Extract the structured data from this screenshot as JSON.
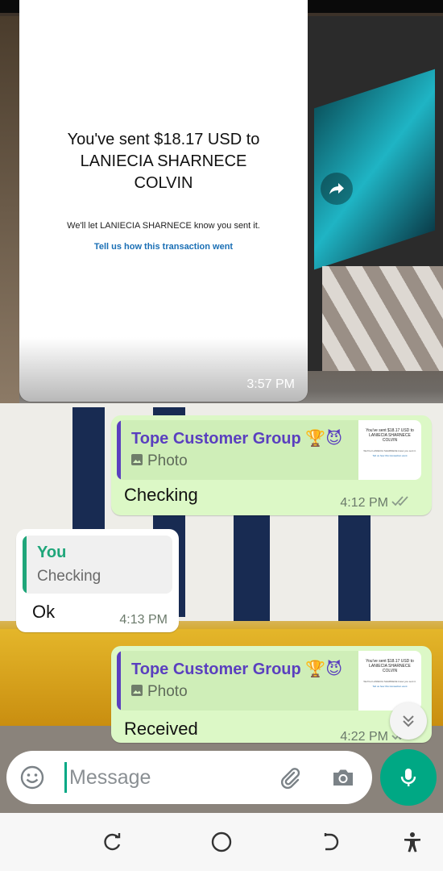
{
  "colors": {
    "outgoing_bubble": "#dcf8c6",
    "incoming_bubble": "#ffffff",
    "accent_green": "#00a884",
    "group_name_purple": "#5a3fbf",
    "you_green": "#1fa67a",
    "link_blue": "#1a6fb5"
  },
  "image_message": {
    "receipt_title": "You've sent $18.17 USD to LANIECIA SHARNECE COLVIN",
    "receipt_note": "We'll let LANIECIA SHARNECE know you sent it.",
    "receipt_link": "Tell us how this transaction went",
    "time": "3:57 PM",
    "forward_icon": "forward-arrow-icon"
  },
  "messages": [
    {
      "direction": "out",
      "quote_author": "Tope Customer Group 🏆😈",
      "quote_type_icon": "image-icon",
      "quote_type_label": "Photo",
      "quote_thumb_title": "You've sent $18.17 USD to LANIECIA SHARNECE COLVIN",
      "quote_thumb_note": "We'll let LANIECIA SHARNECE know you sent it.",
      "quote_thumb_link": "Tell us how this transaction went",
      "text": "Checking",
      "time": "4:12 PM",
      "status_icon": "double-check-icon"
    },
    {
      "direction": "in",
      "quote_author": "You",
      "quote_text": "Checking",
      "text": "Ok",
      "time": "4:13 PM"
    },
    {
      "direction": "out",
      "quote_author": "Tope Customer Group 🏆😈",
      "quote_type_icon": "image-icon",
      "quote_type_label": "Photo",
      "quote_thumb_title": "You've sent $18.17 USD to LANIECIA SHARNECE COLVIN",
      "quote_thumb_note": "We'll let LANIECIA SHARNECE know you sent it.",
      "quote_thumb_link": "Tell us how this transaction went",
      "text": "Received",
      "time": "4:22 PM",
      "status_icon": "double-check-icon"
    }
  ],
  "composer": {
    "placeholder": "Message",
    "emoji_icon": "emoji-icon",
    "attach_icon": "paperclip-icon",
    "camera_icon": "camera-icon",
    "mic_icon": "microphone-icon"
  },
  "scroll_down_icon": "double-chevron-down-icon",
  "navbar": {
    "recents_icon": "recents-icon",
    "home_icon": "home-icon",
    "back_icon": "back-icon",
    "accessibility_icon": "accessibility-icon"
  }
}
